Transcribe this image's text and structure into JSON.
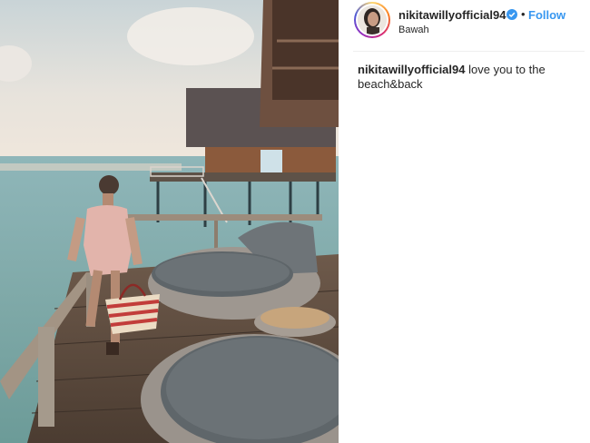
{
  "post": {
    "username": "nikitawillyofficial94",
    "location": "Bawah",
    "follow_label": "Follow",
    "separator": "•",
    "caption_text": "love you to the beach&back"
  },
  "colors": {
    "accent": "#3897f0",
    "text": "#262626",
    "divider": "#efefef",
    "verified": "#3897f0"
  },
  "icons": {
    "verified": "verified-badge-icon"
  }
}
